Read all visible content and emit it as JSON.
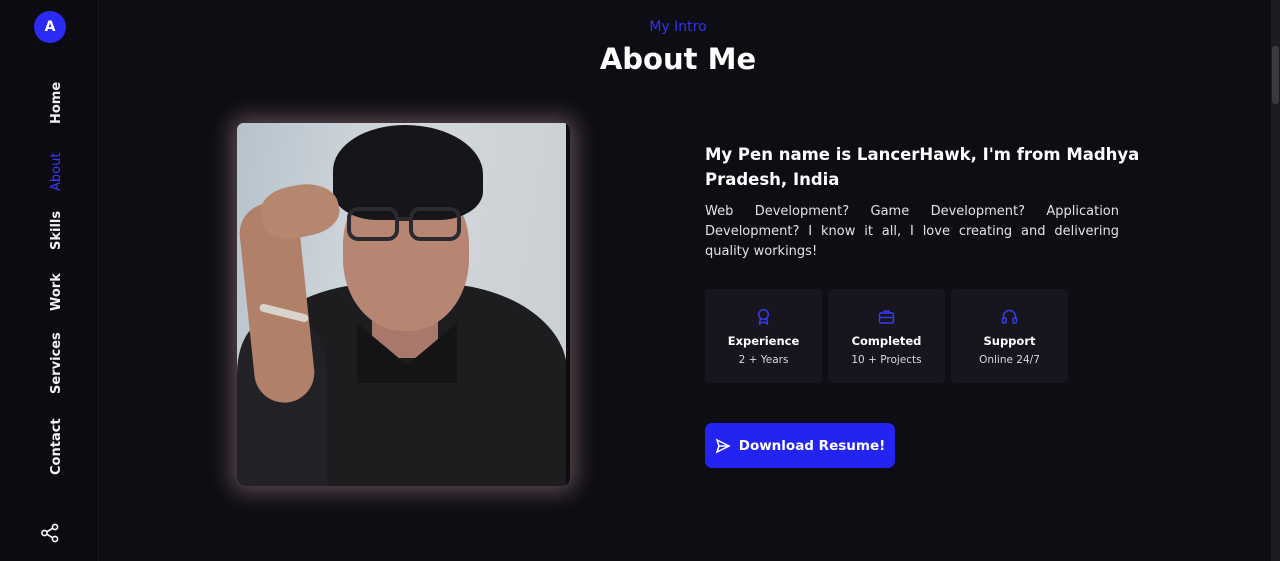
{
  "sidebar": {
    "logo_letter": "A",
    "nav": [
      "Home",
      "About",
      "Skills",
      "Work",
      "Services",
      "Contact"
    ],
    "active": "About"
  },
  "section": {
    "intro": "My Intro",
    "title": "About Me"
  },
  "about": {
    "headline": "My Pen name is LancerHawk, I'm from Madhya Pradesh, India",
    "description": "Web Development? Game Development? Application Development? I know it all, I love creating and delivering quality workings!"
  },
  "cards": [
    {
      "icon": "award-icon",
      "title": "Experience",
      "subtitle": "2 + Years"
    },
    {
      "icon": "briefcase-icon",
      "title": "Completed",
      "subtitle": "10 + Projects"
    },
    {
      "icon": "headphones-icon",
      "title": "Support",
      "subtitle": "Online 24/7"
    }
  ],
  "button": {
    "label": "Download Resume!",
    "icon": "send-icon"
  },
  "colors": {
    "accent": "#2424f2",
    "background": "#0e0d14",
    "card": "#17161e"
  }
}
